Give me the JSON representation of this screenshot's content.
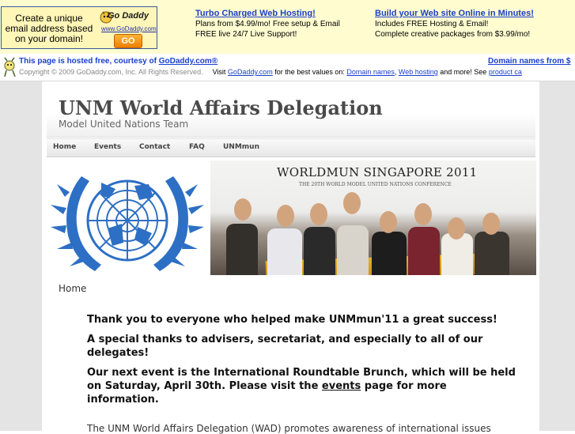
{
  "ad": {
    "box_text": "Create a unique email address based on your domain!",
    "logo_text": "Go Daddy",
    "logo_url": "www.GoDaddy.com",
    "go_label": "GO",
    "col1": {
      "headline": "Turbo Charged Web Hosting!",
      "line1": "Plans from $4.99/mo! Free setup & Email",
      "line2": "FREE live 24/7 Live Support!"
    },
    "col2": {
      "headline": "Build your Web site Online in Minutes!",
      "line1": "Includes FREE Hosting & Email!",
      "line2": "Complete creative packages from $3.99/mo!"
    }
  },
  "hosted": {
    "prefix": "This page is hosted free, courtesy of ",
    "link": "GoDaddy.com®",
    "right_link": "Domain names from $",
    "copyright": "Copyright © 2009 GoDaddy.com, Inc. All Rights Reserved.",
    "visit_prefix": "Visit ",
    "visit_link": "GoDaddy.com",
    "visit_mid": " for the best values on: ",
    "link_domains": "Domain names",
    "sep": ", ",
    "link_hosting": "Web hosting",
    "more": " and more! See ",
    "link_product": "product ca"
  },
  "site": {
    "title": "UNM World Affairs Delegation",
    "subtitle": "Model United Nations Team"
  },
  "nav": [
    "Home",
    "Events",
    "Contact",
    "FAQ",
    "UNMmun"
  ],
  "photo": {
    "title": "WORLDMUN SINGAPORE 2011",
    "subtitle": "THE 20TH WORLD MODEL UNITED NATIONS CONFERENCE"
  },
  "breadcrumb": "Home",
  "content": {
    "p1": "Thank you to everyone who helped make UNMmun'11 a great success!",
    "p2": "A special thanks to advisers, secretariat, and especially to all of our delegates!",
    "p3_before": "Our next event is the International Roundtable Brunch, which will be held on Saturday, April 30th. Please visit the ",
    "p3_link": "events",
    "p3_after": " page for more information.",
    "intro": "The UNM World Affairs Delegation (WAD) promotes awareness of international issues"
  },
  "colors": {
    "ad_link": "#1a3fcc",
    "ad_background": "#fffdd0",
    "page_background": "#e4e4e4",
    "un_blue": "#2d6fc4"
  }
}
